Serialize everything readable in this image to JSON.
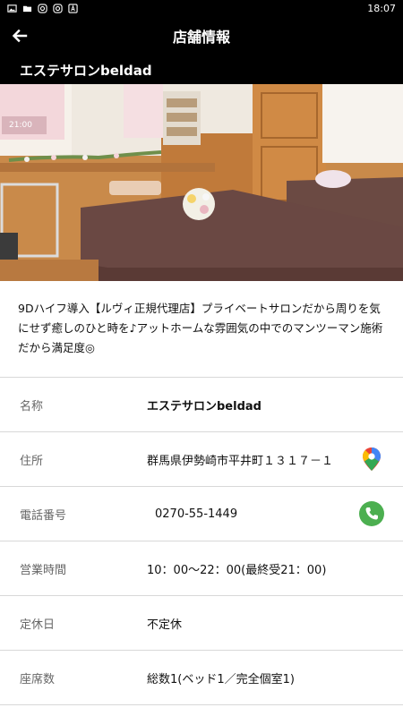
{
  "statusbar": {
    "time": "18:07"
  },
  "appbar": {
    "title": "店舗情報"
  },
  "shop": {
    "name": "エステサロンbeldad"
  },
  "description": "9Dハイフ導入【ルヴィ正規代理店】プライベートサロンだから周りを気にせず癒しのひと時を♪アットホームな雰囲気の中でのマンツーマン施術だから満足度◎",
  "hero_clock": "21:00",
  "info": [
    {
      "label": "名称",
      "value": "エステサロンbeldad"
    },
    {
      "label": "住所",
      "value": "群馬県伊勢崎市平井町１３１７－１"
    },
    {
      "label": "電話番号",
      "value": "0270-55-1449"
    },
    {
      "label": "営業時間",
      "value": "10：00～22：00(最終受21：00)"
    },
    {
      "label": "定休日",
      "value": "不定休"
    },
    {
      "label": "座席数",
      "value": "総数1(ベッド1／完全個室1)"
    }
  ],
  "icons": {
    "back": "arrow-left-icon",
    "map": "google-maps-pin-icon",
    "phone": "phone-icon"
  },
  "colors": {
    "header_bg": "#000000",
    "phone_green": "#4caf50",
    "divider": "#d8d8d8"
  }
}
